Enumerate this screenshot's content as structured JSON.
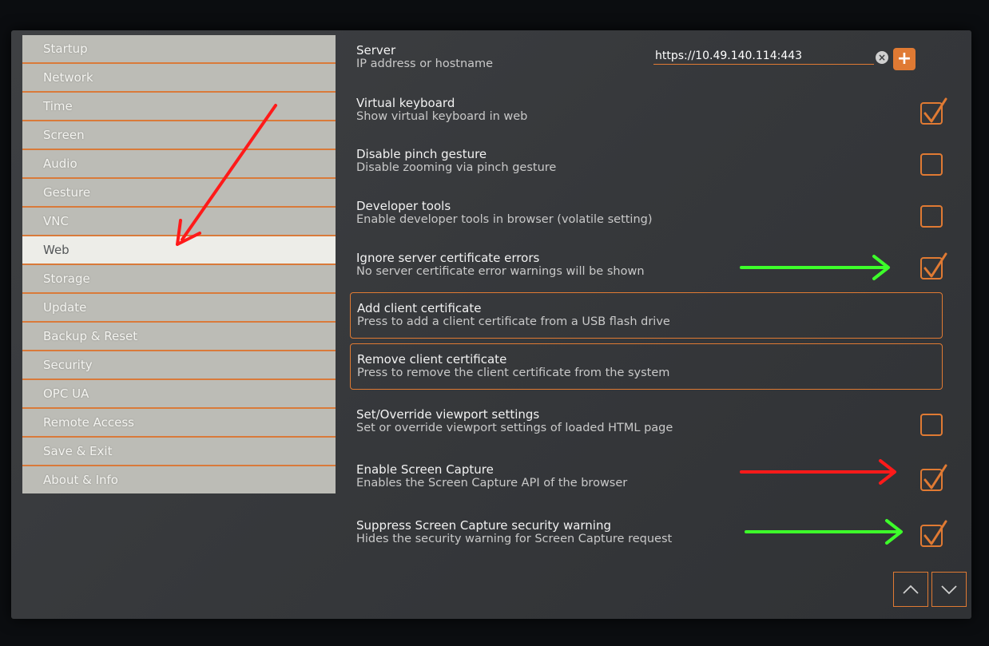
{
  "sidebar": {
    "items": [
      {
        "label": "Startup"
      },
      {
        "label": "Network"
      },
      {
        "label": "Time"
      },
      {
        "label": "Screen"
      },
      {
        "label": "Audio"
      },
      {
        "label": "Gesture"
      },
      {
        "label": "VNC"
      },
      {
        "label": "Web",
        "active": true
      },
      {
        "label": "Storage"
      },
      {
        "label": "Update"
      },
      {
        "label": "Backup & Reset"
      },
      {
        "label": "Security"
      },
      {
        "label": "OPC UA"
      },
      {
        "label": "Remote Access"
      },
      {
        "label": "Save & Exit"
      },
      {
        "label": "About & Info"
      }
    ]
  },
  "server": {
    "title": "Server",
    "desc": "IP address or hostname",
    "value": "https://10.49.140.114:443"
  },
  "settings": [
    {
      "title": "Virtual keyboard",
      "desc": "Show virtual keyboard in web",
      "checked": true
    },
    {
      "title": "Disable pinch gesture",
      "desc": "Disable zooming via pinch gesture",
      "checked": false
    },
    {
      "title": "Developer tools",
      "desc": "Enable developer tools in browser (volatile setting)",
      "checked": false
    },
    {
      "title": "Ignore server certificate errors",
      "desc": "No server certificate error warnings will be shown",
      "checked": true
    }
  ],
  "buttons": [
    {
      "title": "Add client certificate",
      "desc": "Press to add a client certificate from a USB flash drive"
    },
    {
      "title": "Remove client certificate",
      "desc": "Press to remove the client certificate from the system"
    }
  ],
  "settings2": [
    {
      "title": "Set/Override viewport settings",
      "desc": "Set or override viewport settings of loaded HTML page",
      "checked": false
    },
    {
      "title": "Enable Screen Capture",
      "desc": "Enables the Screen Capture API of the browser",
      "checked": true
    },
    {
      "title": "Suppress Screen Capture security warning",
      "desc": "Hides the security warning for Screen Capture request",
      "checked": true
    }
  ],
  "colors": {
    "accent": "#e07a33",
    "annotation_red": "#ff1a1a",
    "annotation_green": "#3dff2a"
  },
  "icons": {
    "clear": "clear-icon",
    "add": "plus-icon",
    "up": "chevron-up-icon",
    "down": "chevron-down-icon"
  }
}
